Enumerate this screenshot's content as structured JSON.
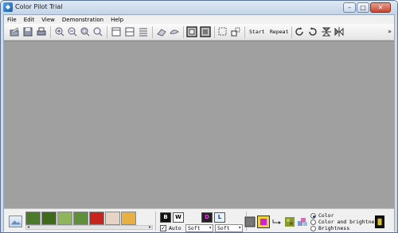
{
  "window": {
    "title": "Color Pilot Trial"
  },
  "menu": [
    "File",
    "Edit",
    "View",
    "Demonstration",
    "Help"
  ],
  "toolbar": {
    "start_label": "Start",
    "repeat_label": "Repeat",
    "overflow": "»"
  },
  "bottom": {
    "auto_label": "Auto",
    "select1": "Soft",
    "select2": "Soft",
    "swatches": [
      "#4a7a2a",
      "#3f6a1c",
      "#8fb55a",
      "#5f8f3a",
      "#c8241e",
      "#e8d4c4",
      "#e8b040"
    ],
    "radio_options": [
      "Color",
      "Color and brightness",
      "Brightness"
    ],
    "radio_selected": "Color",
    "auto_checked": true
  }
}
